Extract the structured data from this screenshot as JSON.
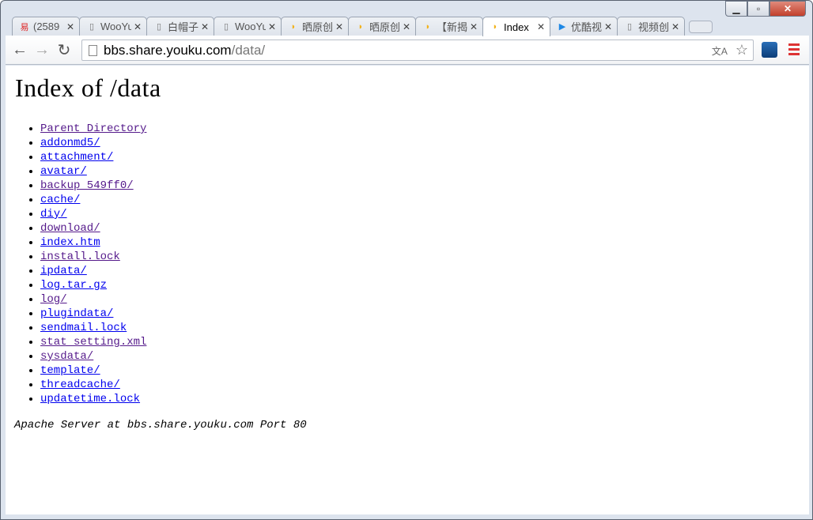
{
  "browser": {
    "tabs": [
      {
        "label": "(2589",
        "icon": "netease-icon"
      },
      {
        "label": "WooYun",
        "icon": "page-icon"
      },
      {
        "label": "白帽子",
        "icon": "page-icon"
      },
      {
        "label": "WooYun",
        "icon": "page-icon"
      },
      {
        "label": "晒原创",
        "icon": "youku-bbs-icon"
      },
      {
        "label": "晒原创",
        "icon": "youku-bbs-icon"
      },
      {
        "label": "【新揭",
        "icon": "youku-bbs-icon"
      },
      {
        "label": "Index",
        "icon": "youku-bbs-icon",
        "active": true
      },
      {
        "label": "优酷视",
        "icon": "youku-play-icon"
      },
      {
        "label": "视频创",
        "icon": "page-icon"
      }
    ],
    "url_host": "bbs.share.youku.com",
    "url_path": "/data/"
  },
  "page": {
    "title": "Index of /data",
    "links": [
      {
        "text": "Parent Directory",
        "visited": true
      },
      {
        "text": "addonmd5/",
        "visited": false
      },
      {
        "text": "attachment/",
        "visited": false
      },
      {
        "text": "avatar/",
        "visited": false
      },
      {
        "text": "backup_549ff0/",
        "visited": true
      },
      {
        "text": "cache/",
        "visited": false
      },
      {
        "text": "diy/",
        "visited": false
      },
      {
        "text": "download/",
        "visited": true
      },
      {
        "text": "index.htm",
        "visited": false
      },
      {
        "text": "install.lock",
        "visited": true
      },
      {
        "text": "ipdata/",
        "visited": false
      },
      {
        "text": "log.tar.gz",
        "visited": false
      },
      {
        "text": "log/",
        "visited": true
      },
      {
        "text": "plugindata/",
        "visited": false
      },
      {
        "text": "sendmail.lock",
        "visited": false
      },
      {
        "text": "stat_setting.xml",
        "visited": true
      },
      {
        "text": "sysdata/",
        "visited": true
      },
      {
        "text": "template/",
        "visited": false
      },
      {
        "text": "threadcache/",
        "visited": false
      },
      {
        "text": "updatetime.lock",
        "visited": false
      }
    ],
    "footer": "Apache Server at bbs.share.youku.com Port 80"
  }
}
